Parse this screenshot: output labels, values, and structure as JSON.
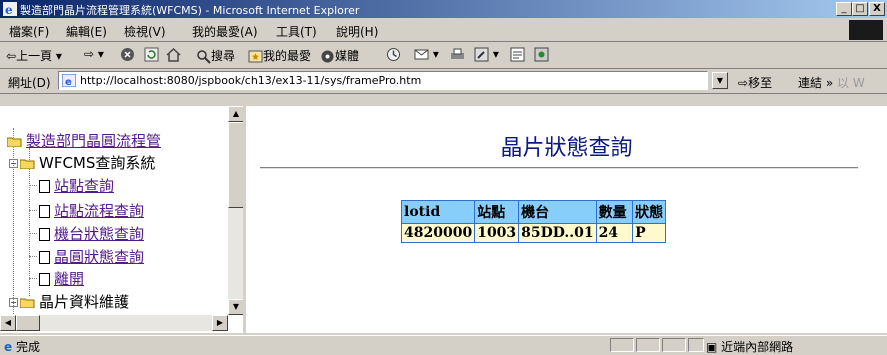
{
  "window": {
    "title": "製造部門晶片流程管理系統(WFCMS) - Microsoft Internet Explorer",
    "minimize": "_",
    "maximize": "□",
    "close": "X"
  },
  "menu": [
    "檔案(F)",
    "編輯(E)",
    "檢視(V)",
    "我的最愛(A)",
    "工具(T)",
    "說明(H)"
  ],
  "toolbar": {
    "back": "上一頁",
    "search": "搜尋",
    "favorites": "我的最愛",
    "media": "媒體"
  },
  "address": {
    "label": "網址(D)",
    "url": "http://localhost:8080/jspbook/ch13/ex13-11/sys/framePro.htm",
    "go": "移至",
    "links": "連結 »",
    "links_extra": "以 W"
  },
  "tree": {
    "root": "製造部門晶圓流程管",
    "system": "WFCMS查詢系統",
    "items": [
      "站點查詢",
      "站點流程查詢",
      "機台狀態查詢",
      "晶圓狀態查詢",
      "離開"
    ],
    "next_folder": "晶片資料維護"
  },
  "main": {
    "title": "晶片狀態查詢",
    "table": {
      "headers": [
        "lotid",
        "站點",
        "機台",
        "數量",
        "狀態"
      ],
      "rows": [
        [
          "4820000",
          "1003",
          "85DD..01",
          "24",
          "P"
        ]
      ]
    }
  },
  "status": {
    "done": "完成",
    "zone": "近端內部網路"
  }
}
